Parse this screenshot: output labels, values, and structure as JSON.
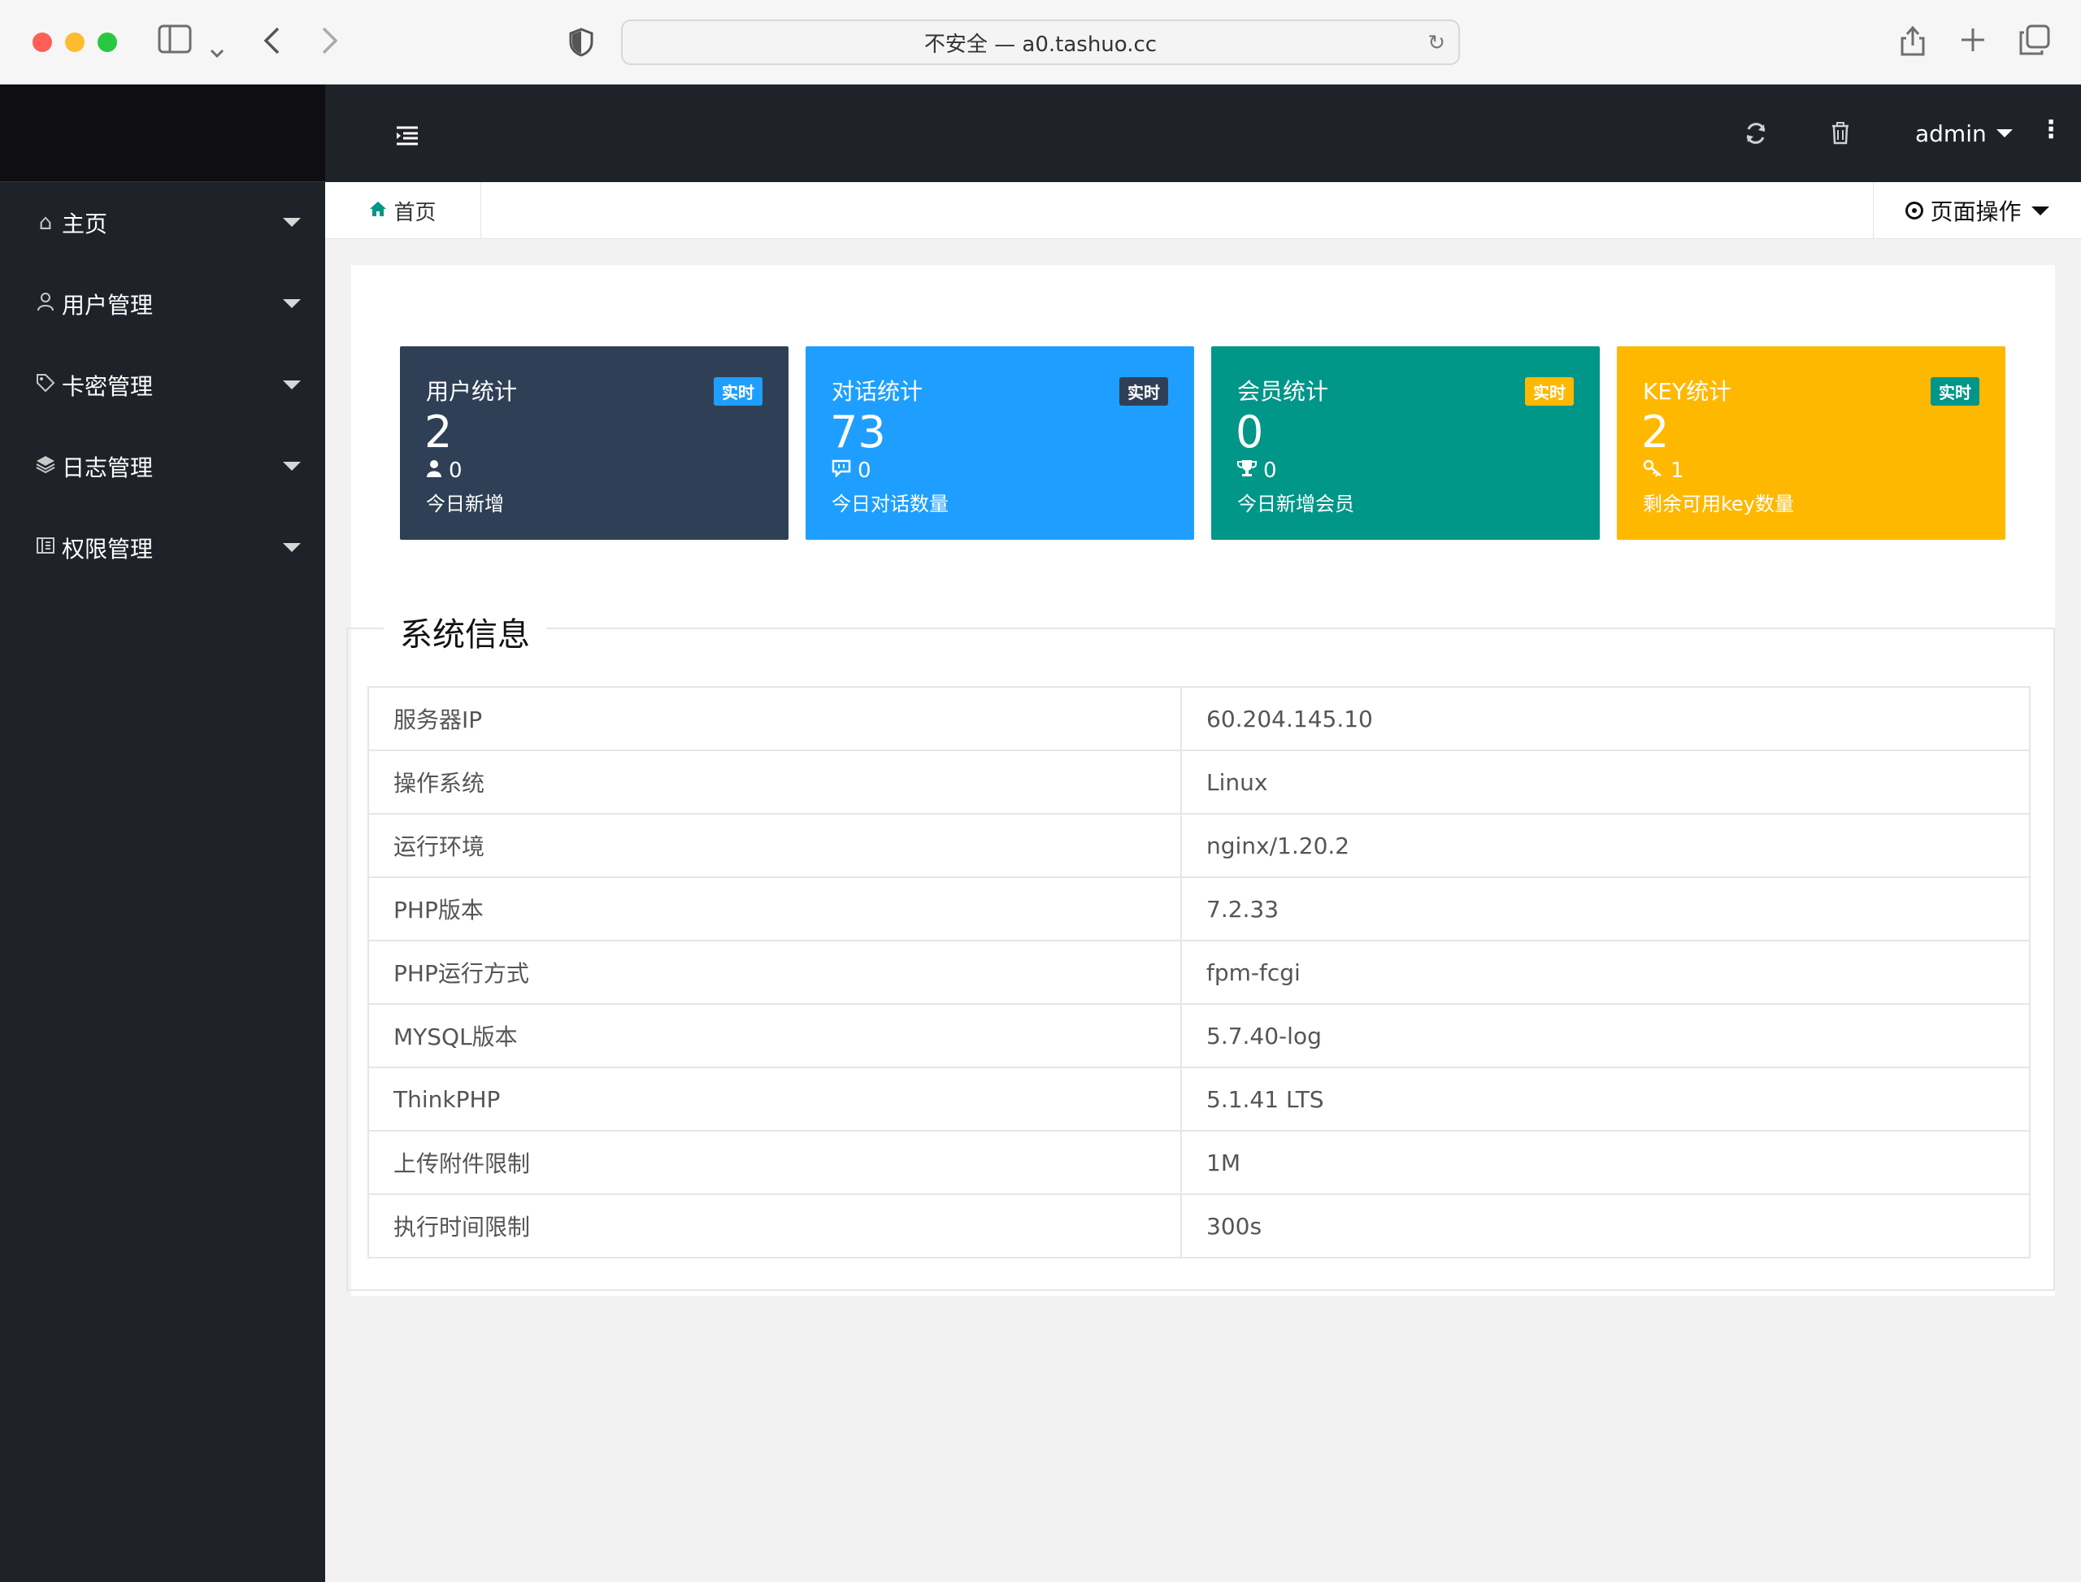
{
  "browser": {
    "address": "不安全 — a0.tashuo.cc",
    "icons": [
      "sidebar-toggle-icon",
      "chevron-down-icon",
      "back-icon",
      "forward-icon",
      "shield-icon",
      "reload-icon",
      "share-icon",
      "plus-icon",
      "tabs-overview-icon"
    ]
  },
  "sidebar": {
    "items": [
      {
        "label": "主页",
        "icon": "home-icon"
      },
      {
        "label": "用户管理",
        "icon": "user-icon"
      },
      {
        "label": "卡密管理",
        "icon": "tag-icon"
      },
      {
        "label": "日志管理",
        "icon": "layers-icon"
      },
      {
        "label": "权限管理",
        "icon": "permission-icon"
      }
    ]
  },
  "header": {
    "user": "admin",
    "icons": [
      "menu-collapse-icon",
      "refresh-icon",
      "trash-icon",
      "more-vertical-icon"
    ]
  },
  "tabs": {
    "home_label": "首页",
    "page_ops_label": "页面操作"
  },
  "stats": [
    {
      "title": "用户统计",
      "badge": "实时",
      "value": "2",
      "sub_value": "0",
      "sub_icon": "user-icon",
      "desc": "今日新增",
      "color": "#2f4056"
    },
    {
      "title": "对话统计",
      "badge": "实时",
      "value": "73",
      "sub_value": "0",
      "sub_icon": "chat-icon",
      "desc": "今日对话数量",
      "color": "#1e9fff"
    },
    {
      "title": "会员统计",
      "badge": "实时",
      "value": "0",
      "sub_value": "0",
      "sub_icon": "trophy-icon",
      "desc": "今日新增会员",
      "color": "#009688"
    },
    {
      "title": "KEY统计",
      "badge": "实时",
      "value": "2",
      "sub_value": "1",
      "sub_icon": "key-icon",
      "desc": "剩余可用key数量",
      "color": "#ffb800"
    }
  ],
  "sysinfo": {
    "legend": "系统信息",
    "rows": [
      {
        "key": "服务器IP",
        "value": "60.204.145.10"
      },
      {
        "key": "操作系统",
        "value": "Linux"
      },
      {
        "key": "运行环境",
        "value": "nginx/1.20.2"
      },
      {
        "key": "PHP版本",
        "value": "7.2.33"
      },
      {
        "key": "PHP运行方式",
        "value": "fpm-fcgi"
      },
      {
        "key": "MYSQL版本",
        "value": "5.7.40-log"
      },
      {
        "key": "ThinkPHP",
        "value": "5.1.41 LTS"
      },
      {
        "key": "上传附件限制",
        "value": "1M"
      },
      {
        "key": "执行时间限制",
        "value": "300s"
      }
    ]
  }
}
